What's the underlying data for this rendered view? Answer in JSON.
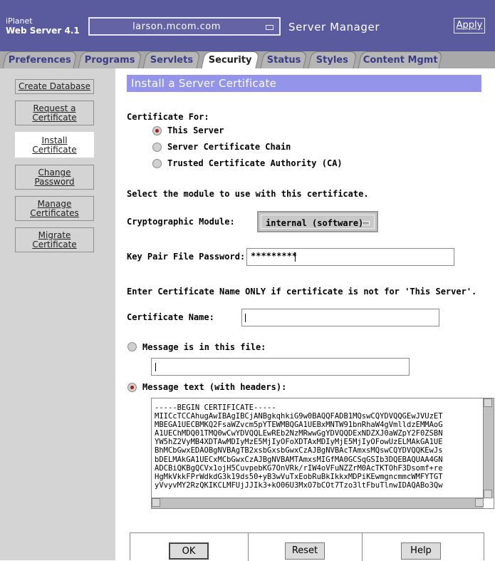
{
  "header": {
    "brand_line1": "iPlanet",
    "brand_line2": "Web Server 4.1",
    "server_select_value": "larson.mcom.com",
    "app_title": "Server Manager",
    "apply_label": "Apply"
  },
  "tabs": [
    {
      "label": "Preferences"
    },
    {
      "label": "Programs"
    },
    {
      "label": "Servlets"
    },
    {
      "label": "Security",
      "active": true
    },
    {
      "label": "Status"
    },
    {
      "label": "Styles"
    },
    {
      "label": "Content Mgmt"
    }
  ],
  "sidebar": {
    "items": [
      {
        "label": "Create Database"
      },
      {
        "label": "Request a Certificate"
      },
      {
        "label": "Install Certificate",
        "active": true
      },
      {
        "label": "Change Password"
      },
      {
        "label": "Manage Certificates"
      },
      {
        "label": "Migrate Certificate"
      }
    ]
  },
  "form": {
    "title": "Install a Server Certificate",
    "cert_for_label": "Certificate For:",
    "radio_this_server": "This Server",
    "radio_chain": "Server Certificate Chain",
    "radio_ca": "Trusted Certificate Authority (CA)",
    "module_instruction": "Select the module to use with this certificate.",
    "module_label": "Cryptographic Module:",
    "module_value": "internal (software)",
    "keypair_label": "Key Pair File Password:",
    "keypair_value": "*********",
    "name_instruction": "Enter Certificate Name ONLY if certificate is not for 'This Server'.",
    "cert_name_label": "Certificate Name:",
    "cert_name_value": "",
    "file_label": "Message is in this file:",
    "file_value": "",
    "text_label": "Message text (with headers):",
    "cert_text_lines": [
      "-----BEGIN CERTIFICATE-----",
      "MIICcTCCAhugAwIBAgIBCjANBgkqhkiG9w0BAQQFADB1MQswCQYDVQQGEwJVUzET",
      "MBEGA1UECBMKQ2FsaWZvcm5pYTEWMBQGA1UEBxMNTW91bnRhaW4gVmlldzEMMAoG",
      "A1UEChMDQ01TMQ0wCwYDVQQLEwREb2NzMRwwGgYDVQQDExNDZXJ0aWZpY2F0ZSBN",
      "YW5hZ2VyMB4XDTAwMDIyMzE5MjIyOFoXDTAxMDIyMjE5MjIyOFowUzELMAkGA1UE",
      "BhMCbGwxEDAOBgNVBAgTB2xsbGxsbGwxCzAJBgNVBAcTAmxsMQswCQYDVQQKEwJs",
      "bDELMAkGA1UECxMCbGwxCzAJBgNVBAMTAmxsMIGfMA0GCSqGSIb3DQEBAQUAA4GN",
      "ADCBiQKBgQCVx1ojH5CuvpebKG7OnVRk/rIW4oVFuNZZrM0AcTKTOhF3Dsomf+re",
      "HgMkVkkFPrWdkdG3k19ds50+yB3wVuTxEobRuBkIkkxMDPiKEwmgncmmcWMFYTGT",
      "yVvyvMY2RzQKIKCLMFUjJJIk3+kO06U3MxO7bCOt7Tzo3ltFbuTlnwIDAQABo3Qw"
    ]
  },
  "buttons": {
    "ok": "OK",
    "reset": "Reset",
    "help": "Help"
  }
}
